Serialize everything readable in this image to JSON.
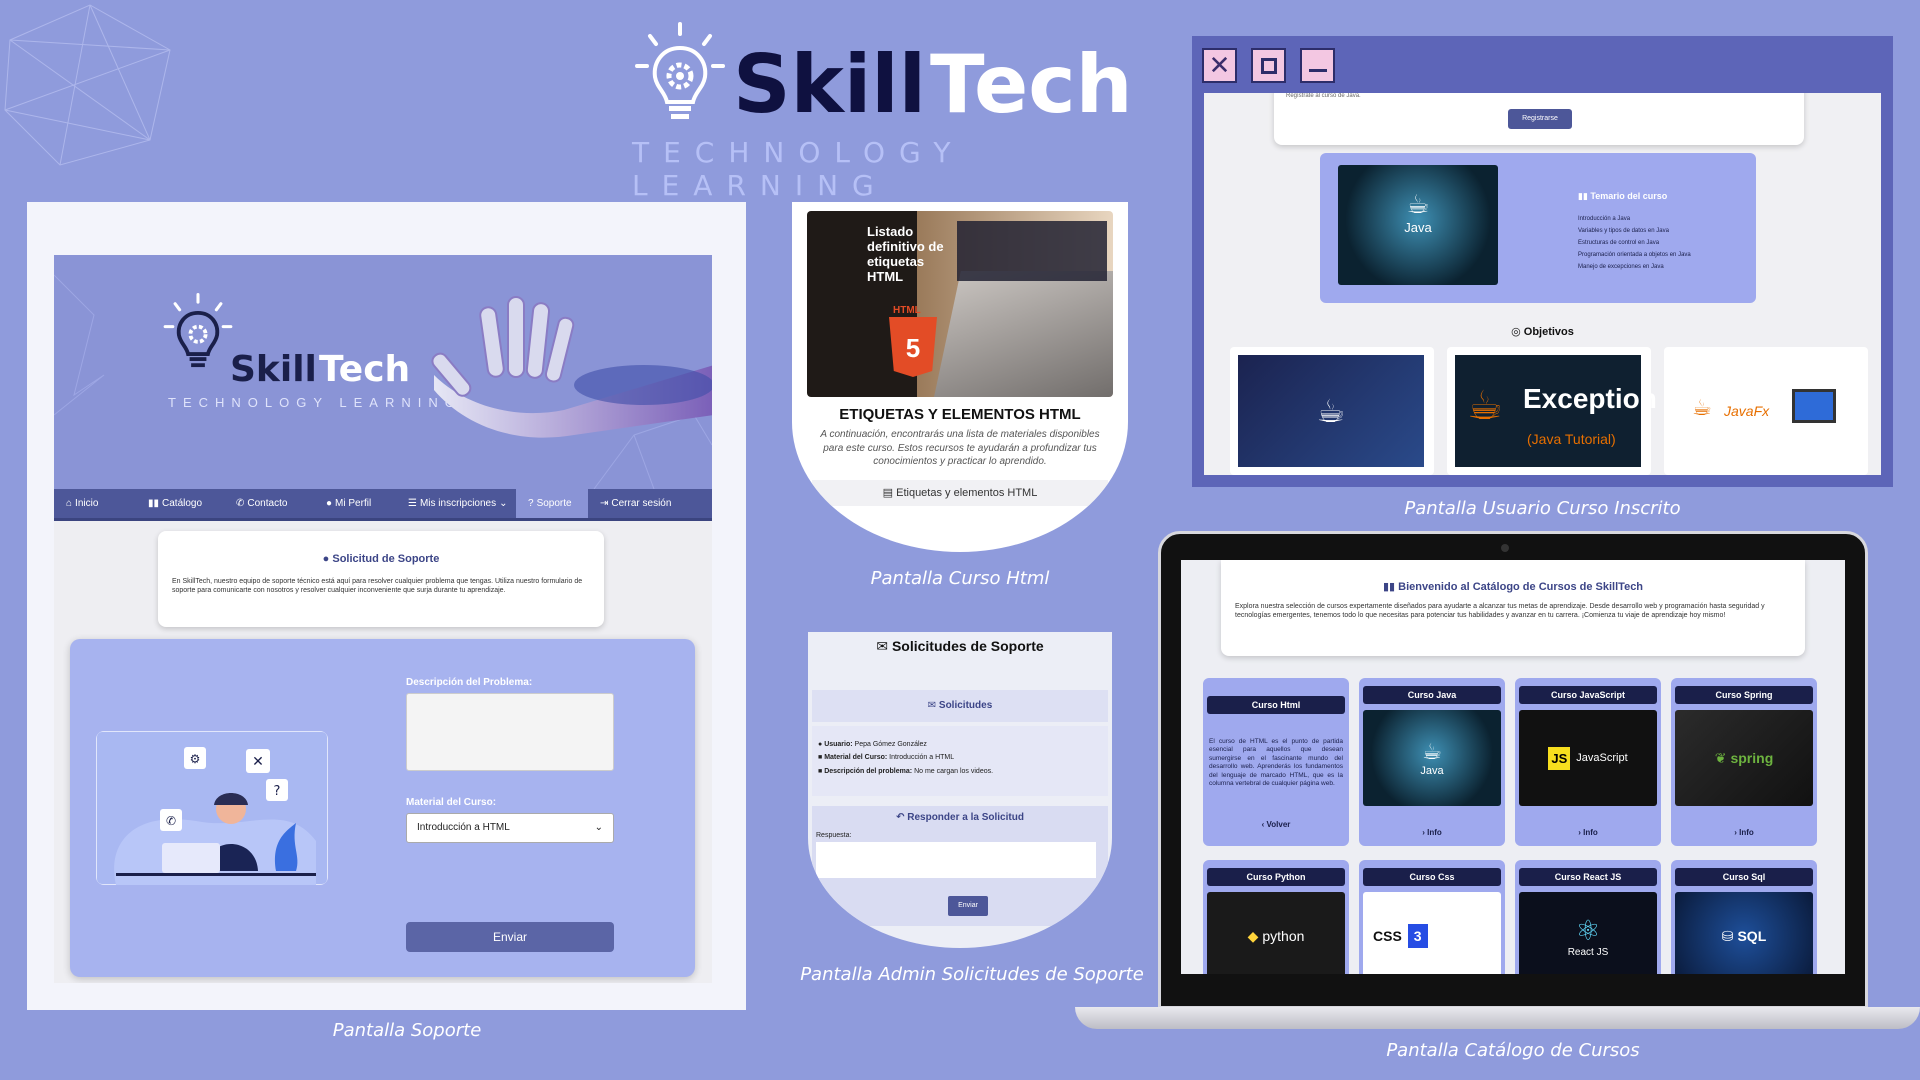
{
  "brand": {
    "name_part1": "Skill",
    "name_part2": "Tech",
    "tagline": "TECHNOLOGY LEARNING"
  },
  "soporte": {
    "banner_name_part1": "Skill",
    "banner_name_part2": "Tech",
    "banner_tagline": "TECHNOLOGY LEARNING",
    "nav": [
      {
        "label": "Inicio",
        "icon": "home-icon"
      },
      {
        "label": "Catálogo",
        "icon": "book-icon"
      },
      {
        "label": "Contacto",
        "icon": "phone-icon"
      },
      {
        "label": "Mi Perfil",
        "icon": "user-icon"
      },
      {
        "label": "Mis inscripciones",
        "icon": "list-icon"
      },
      {
        "label": "Soporte",
        "icon": "help-icon"
      },
      {
        "label": "Cerrar sesión",
        "icon": "logout-icon"
      }
    ],
    "card_title": "Solicitud de Soporte",
    "card_text": "En SkillTech, nuestro equipo de soporte técnico está aquí para resolver cualquier problema que tengas. Utiliza nuestro formulario de soporte para comunicarte con nosotros y resolver cualquier inconveniente que surja durante tu aprendizaje.",
    "desc_label": "Descripción del Problema:",
    "material_label": "Material del Curso:",
    "material_value": "Introducción a HTML",
    "submit_label": "Enviar",
    "caption": "Pantalla Soporte"
  },
  "curso_html": {
    "image_text": "Listado definitivo de etiquetas HTML",
    "image_badge": "HTML",
    "title": "ETIQUETAS Y ELEMENTOS HTML",
    "description": "A continuación, encontrarás una lista de materiales disponibles para este curso. Estos recursos te ayudarán a profundizar tus conocimientos y practicar lo aprendido.",
    "material_link": "Etiquetas y elementos HTML",
    "caption": "Pantalla Curso Html"
  },
  "admin": {
    "title": "Solicitudes de Soporte",
    "section_title": "Solicitudes",
    "usuario_label": "Usuario:",
    "usuario_value": "Pepa Gómez González",
    "material_label": "Material del Curso:",
    "material_value": "Introducción a HTML",
    "problema_label": "Descripción del problema:",
    "problema_value": "No me cargan los videos.",
    "responder_title": "Responder a la Solicitud",
    "respuesta_label": "Respuesta:",
    "submit_label": "Enviar",
    "caption": "Pantalla Admin Solicitudes de Soporte"
  },
  "usuario_curso": {
    "partial_text": "Regístrate al curso de Java.",
    "register_button": "Registrarse",
    "course_image_label": "Java",
    "temario_title": "Temario del curso",
    "temario_items": [
      "Introducción a Java",
      "Variables y tipos de datos en Java",
      "Estructuras de control en Java",
      "Programación orientada a objetos en Java",
      "Manejo de excepciones en Java"
    ],
    "objetivos_title": "Objetivos",
    "objetivo_images": [
      {
        "label": "",
        "icon": "java-icon"
      },
      {
        "label": "Exception",
        "sublabel": "(Java Tutorial)",
        "icon": "java-icon"
      },
      {
        "label": "JavaFx",
        "icon": "javafx-icon"
      }
    ],
    "caption": "Pantalla  Usuario Curso Inscrito"
  },
  "catalogo": {
    "title": "Bienvenido al Catálogo de Cursos de SkillTech",
    "intro": "Explora nuestra selección de cursos expertamente diseñados para ayudarte a alcanzar tus metas de aprendizaje. Desde desarrollo web y programación hasta seguridad y tecnologías emergentes, tenemos todo lo que necesitas para potenciar tus habilidades y avanzar en tu carrera. ¡Comienza tu viaje de aprendizaje hoy mismo!",
    "html_card": {
      "title": "Curso Html",
      "text": "El curso de HTML es el punto de partida esencial para aquellos que desean sumergirse en el fascinante mundo del desarrollo web. Aprenderás los fundamentos del lenguaje de marcado HTML, que es la columna vertebral de cualquier página web.",
      "back_label": "Volver"
    },
    "courses_row1": [
      {
        "title": "Curso Java",
        "image_label": "Java",
        "info": "Info"
      },
      {
        "title": "Curso JavaScript",
        "image_label": "JavaScript",
        "info": "Info"
      },
      {
        "title": "Curso Spring",
        "image_label": "spring",
        "info": "Info"
      }
    ],
    "courses_row2": [
      {
        "title": "Curso Python",
        "image_label": "python"
      },
      {
        "title": "Curso Css",
        "image_label": "CSS"
      },
      {
        "title": "Curso React JS",
        "image_label": "React JS"
      },
      {
        "title": "Curso Sql",
        "image_label": "SQL"
      }
    ],
    "caption": "Pantalla  Catálogo de Cursos"
  }
}
